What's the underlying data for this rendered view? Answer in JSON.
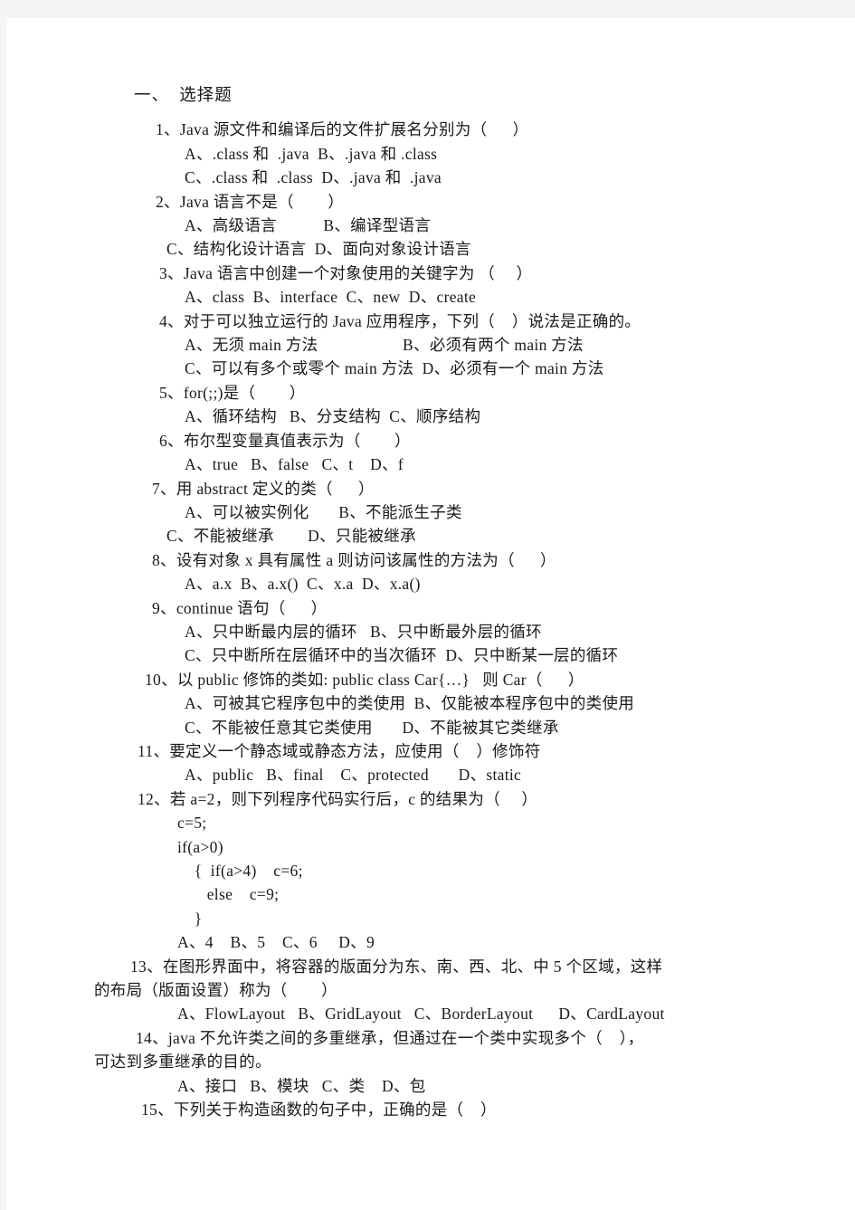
{
  "document": {
    "section_heading": "一、  选择题",
    "lines": [
      {
        "id": "q1",
        "text": "1、Java 源文件和编译后的文件扩展名分别为（      ）"
      },
      {
        "id": "q1a",
        "text": "A、.class 和  .java  B、.java 和 .class"
      },
      {
        "id": "q1b",
        "text": "C、.class 和  .class  D、.java 和  .java"
      },
      {
        "id": "q2",
        "text": "2、Java 语言不是（        ）"
      },
      {
        "id": "q2a",
        "text": "A、高级语言           B、编译型语言"
      },
      {
        "id": "q2b",
        "text": "C、结构化设计语言  D、面向对象设计语言"
      },
      {
        "id": "q3",
        "text": "3、Java 语言中创建一个对象使用的关键字为 （     ）"
      },
      {
        "id": "q3a",
        "text": "A、class  B、interface  C、new  D、create"
      },
      {
        "id": "q4",
        "text": "4、对于可以独立运行的 Java 应用程序，下列（    ）说法是正确的。"
      },
      {
        "id": "q4a",
        "text": "A、无须 main 方法                    B、必须有两个 main 方法"
      },
      {
        "id": "q4b",
        "text": "C、可以有多个或零个 main 方法  D、必须有一个 main 方法"
      },
      {
        "id": "q5",
        "text": "5、for(;;)是（        ）"
      },
      {
        "id": "q5a",
        "text": "A、循环结构   B、分支结构  C、顺序结构"
      },
      {
        "id": "q6",
        "text": "6、布尔型变量真值表示为（        ）"
      },
      {
        "id": "q6a",
        "text": "A、true   B、false   C、t    D、f"
      },
      {
        "id": "q7",
        "text": "7、用 abstract 定义的类（      ）"
      },
      {
        "id": "q7a",
        "text": "A、可以被实例化       B、不能派生子类"
      },
      {
        "id": "q7b",
        "text": "C、不能被继承        D、只能被继承"
      },
      {
        "id": "q8",
        "text": "8、设有对象 x 具有属性 a 则访问该属性的方法为（      ）"
      },
      {
        "id": "q8a",
        "text": "A、a.x  B、a.x()  C、x.a  D、x.a()"
      },
      {
        "id": "q9",
        "text": "9、continue 语句（      ）"
      },
      {
        "id": "q9a",
        "text": "A、只中断最内层的循环   B、只中断最外层的循环"
      },
      {
        "id": "q9b",
        "text": "C、只中断所在层循环中的当次循环  D、只中断某一层的循环"
      },
      {
        "id": "q10",
        "text": "10、以 public 修饰的类如: public class Car{…}   则 Car（      ）"
      },
      {
        "id": "q10a",
        "text": "A、可被其它程序包中的类使用  B、仅能被本程序包中的类使用"
      },
      {
        "id": "q10b",
        "text": "C、不能被任意其它类使用       D、不能被其它类继承"
      },
      {
        "id": "q11",
        "text": "11、要定义一个静态域或静态方法，应使用（    ）修饰符"
      },
      {
        "id": "q11a",
        "text": "A、public   B、final    C、protected       D、static"
      },
      {
        "id": "q12",
        "text": "12、若 a=2，则下列程序代码实行后，c 的结果为（     ）"
      },
      {
        "id": "q12c1",
        "text": "c=5;"
      },
      {
        "id": "q12c2",
        "text": "if(a>0)"
      },
      {
        "id": "q12c3",
        "text": "    {  if(a>4)    c=6;"
      },
      {
        "id": "q12c4",
        "text": "       else    c=9;"
      },
      {
        "id": "q12c5",
        "text": "    }"
      },
      {
        "id": "q12a",
        "text": "A、4    B、5    C、6     D、9"
      },
      {
        "id": "q13l1",
        "text": "13、在图形界面中，将容器的版面分为东、南、西、北、中 5 个区域，这样"
      },
      {
        "id": "q13l2",
        "text": "的布局（版面设置）称为（        ）"
      },
      {
        "id": "q13a",
        "text": "A、FlowLayout   B、GridLayout   C、BorderLayout      D、CardLayout"
      },
      {
        "id": "q14l1",
        "text": "14、java 不允许类之间的多重继承，但通过在一个类中实现多个（    ），"
      },
      {
        "id": "q14l2",
        "text": "可达到多重继承的目的。"
      },
      {
        "id": "q14a",
        "text": "A、接口   B、模块   C、类    D、包"
      },
      {
        "id": "q15",
        "text": "15、下列关于构造函数的句子中，正确的是（    ）"
      }
    ]
  }
}
